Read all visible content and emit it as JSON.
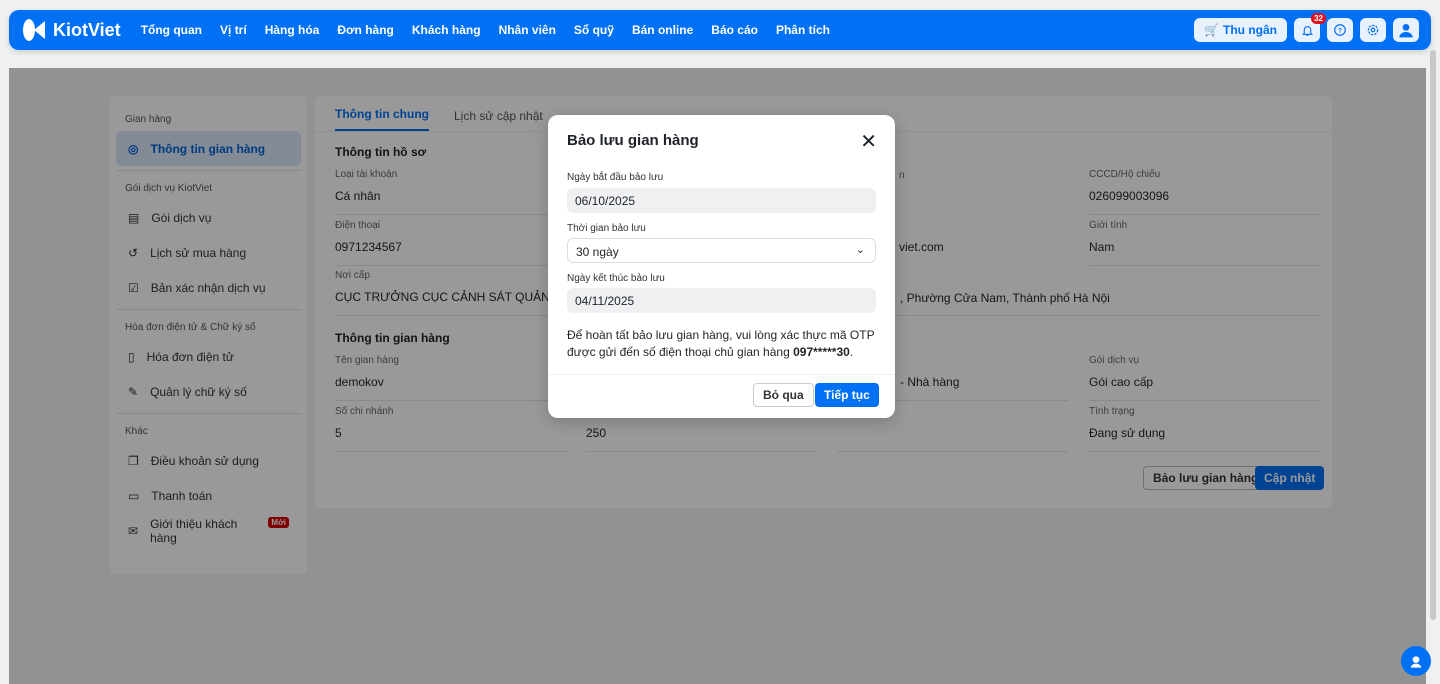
{
  "header": {
    "brand": "KiotViet",
    "nav": [
      "Tổng quan",
      "Vị trí",
      "Hàng hóa",
      "Đơn hàng",
      "Khách hàng",
      "Nhân viên",
      "Sổ quỹ",
      "Bán online",
      "Báo cáo",
      "Phân tích"
    ],
    "cashier": "Thu ngân",
    "notifications": "32"
  },
  "sidebar": {
    "groups": [
      {
        "title": "Gian hàng",
        "items": [
          "Thông tin gian hàng"
        ]
      },
      {
        "title": "Gói dịch vụ KiotViet",
        "items": [
          "Gói dịch vụ",
          "Lịch sử mua hàng",
          "Bản xác nhận dịch vụ"
        ]
      },
      {
        "title": "Hóa đơn điện tử & Chữ ký số",
        "items": [
          "Hóa đơn điện tử",
          "Quản lý chữ ký số"
        ]
      },
      {
        "title": "Khác",
        "items": [
          "Điều khoản sử dụng",
          "Thanh toán",
          "Giới thiệu khách hàng"
        ]
      }
    ],
    "new_badge": "Mới"
  },
  "main": {
    "tabs": [
      "Thông tin chung",
      "Lịch sử cập nhật"
    ],
    "profile_title": "Thông tin hồ sơ",
    "store_title": "Thông tin gian hàng",
    "fields": {
      "account_type": {
        "label": "Loại tài khoản",
        "value": "Cá nhân"
      },
      "phone": {
        "label": "Điện thoại",
        "value": "0971234567"
      },
      "issued_by": {
        "label": "Nơi cấp",
        "value": "CỤC TRƯỞNG CỤC CẢNH SÁT QUẢN LÝ"
      },
      "id_card": {
        "label": "CCCD/Hộ chiếu",
        "value": "026099003096"
      },
      "gender": {
        "label": "Giới tính",
        "value": "Nam"
      },
      "email_partial": "viet.com",
      "address_partial": ", Phường Cửa Nam, Thành phố Hà Nội",
      "store_name": {
        "label": "Tên gian hàng",
        "value": "demokov"
      },
      "branches": {
        "label": "Số chi nhánh",
        "value": "5"
      },
      "col2_value": "250",
      "industry_partial": "- Nhà hàng",
      "label_partial": "n",
      "package": {
        "label": "Gói dịch vụ",
        "value": "Gói cao cấp"
      },
      "status": {
        "label": "Tình trạng",
        "value": "Đang sử dụng"
      }
    },
    "reserve_button": "Bảo lưu gian hàng",
    "update_button": "Cập nhật"
  },
  "modal": {
    "title": "Bảo lưu gian hàng",
    "start_label": "Ngày bắt đầu bảo lưu",
    "start_value": "06/10/2025",
    "duration_label": "Thời gian bảo lưu",
    "duration_value": "30 ngày",
    "end_label": "Ngày kết thúc bảo lưu",
    "end_value": "04/11/2025",
    "note": "Để hoàn tất bảo lưu gian hàng, vui lòng xác thực mã OTP được gửi đến số điện thoại chủ gian hàng ",
    "phone_masked": "097*****30",
    "note_end": ".",
    "skip": "Bỏ qua",
    "continue": "Tiếp tục"
  },
  "colors": {
    "brand": "#0070f4",
    "badge": "#e0101e"
  }
}
